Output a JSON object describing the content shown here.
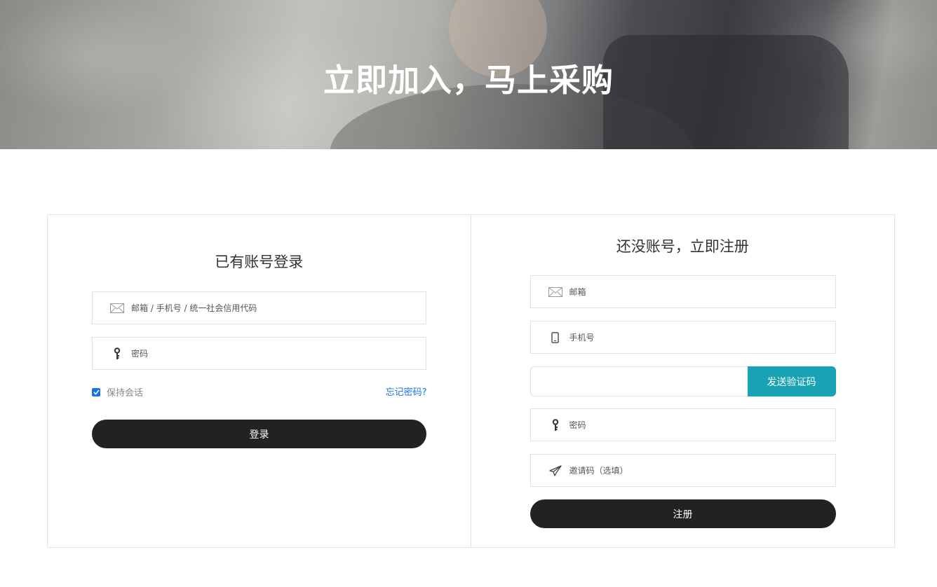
{
  "banner": {
    "title": "立即加入，马上采购"
  },
  "login": {
    "title": "已有账号登录",
    "account": {
      "placeholder": "邮箱 / 手机号 / 统一社会信用代码",
      "icon": "envelope-icon"
    },
    "password": {
      "placeholder": "密码",
      "icon": "key-icon"
    },
    "remember": {
      "label": "保持会话",
      "checked": true
    },
    "forgot_label": "忘记密码?",
    "submit_label": "登录"
  },
  "register": {
    "title": "还没账号，立即注册",
    "email": {
      "placeholder": "邮箱",
      "icon": "envelope-icon"
    },
    "phone": {
      "placeholder": "手机号",
      "icon": "mobile-phone-icon"
    },
    "code": {
      "placeholder": "",
      "send_label": "发送验证码"
    },
    "password": {
      "placeholder": "密码",
      "icon": "key-icon"
    },
    "invite": {
      "placeholder": "邀请码（选填）",
      "icon": "paper-plane-icon"
    },
    "submit_label": "注册"
  },
  "colors": {
    "accent_blue": "#1a73e8",
    "send_button": "#19a2b3",
    "dark_button": "#222222",
    "border": "#e1e1e1"
  }
}
